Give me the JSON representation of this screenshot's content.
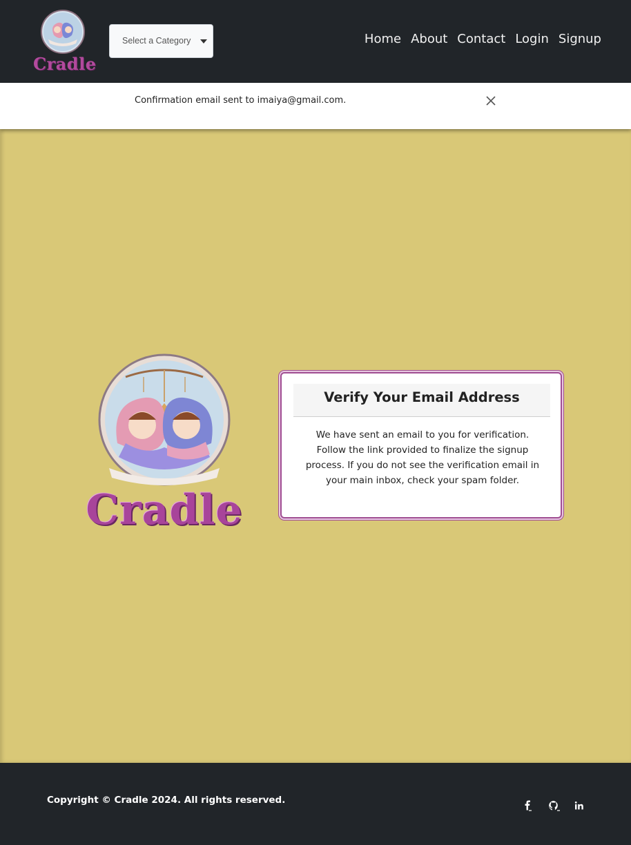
{
  "navbar": {
    "brand_text": "Cradle",
    "category_select": {
      "selected": "Select a Category"
    },
    "links": [
      "Home",
      "About",
      "Contact",
      "Login",
      "Signup"
    ]
  },
  "alert": {
    "message": "Confirmation email sent to imaiya@gmail.com.",
    "close_icon": "close-icon"
  },
  "hero": {
    "logo_text": "Cradle"
  },
  "verify_card": {
    "title": "Verify Your Email Address",
    "body": "We have sent an email to you for verification. Follow the link provided to finalize the signup process. If you do not see the verification email in your main inbox, check your spam folder."
  },
  "footer": {
    "copyright": "Copyright © Cradle 2024. All rights reserved.",
    "social_icons": [
      "facebook-icon",
      "github-icon",
      "linkedin-icon"
    ]
  },
  "colors": {
    "navbar_bg": "#212529",
    "main_bg": "#d9c877",
    "brand_purple": "#a8449a"
  }
}
